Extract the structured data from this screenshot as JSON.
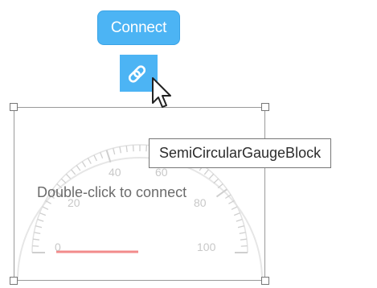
{
  "toolbar": {
    "connect_label": "Connect",
    "link_icon": "link-icon"
  },
  "gauge": {
    "label_min": "0",
    "label_20": "20",
    "label_40": "40",
    "label_60": "60",
    "label_80": "80",
    "label_max": "100",
    "value_bar_color": "#f28b8b",
    "overlay_message": "Double-click to connect"
  },
  "tooltip": {
    "text": "SemiCircularGaugeBlock"
  },
  "colors": {
    "accent": "#4cb4f4"
  }
}
